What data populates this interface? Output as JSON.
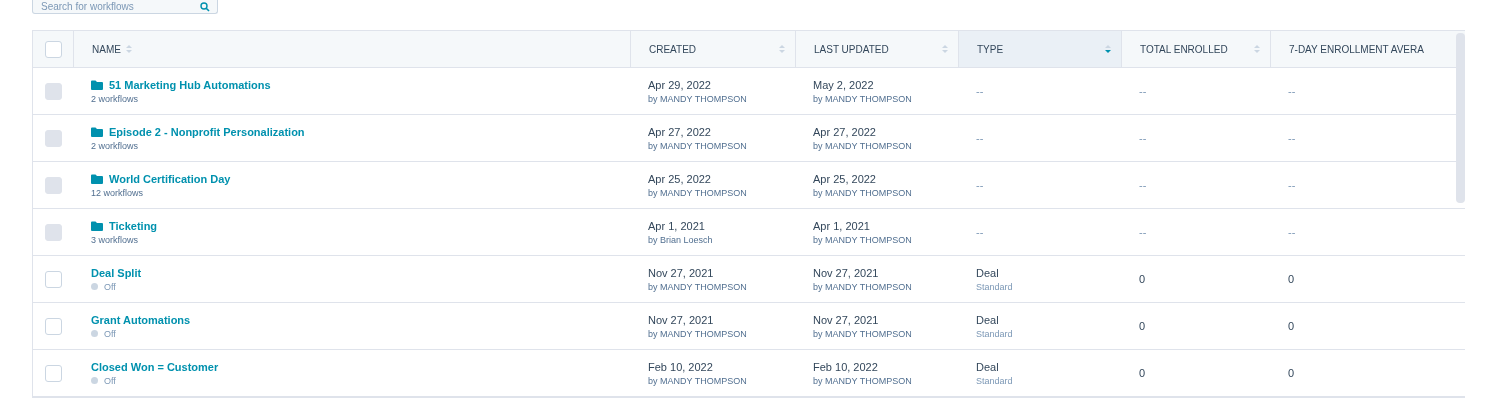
{
  "search": {
    "placeholder": "Search for workflows"
  },
  "table": {
    "select_all": {
      "checked": false
    },
    "columns": [
      {
        "label": "NAME",
        "sortable": true,
        "sorted": false
      },
      {
        "label": "CREATED",
        "sortable": true,
        "sorted": false
      },
      {
        "label": "LAST UPDATED",
        "sortable": true,
        "sorted": false
      },
      {
        "label": "TYPE",
        "sortable": true,
        "sorted": true
      },
      {
        "label": "TOTAL ENROLLED",
        "sortable": true,
        "sorted": false
      },
      {
        "label": "7-DAY ENROLLMENT AVERA",
        "sortable": false
      }
    ],
    "rows": [
      {
        "kind": "folder",
        "disabled": true,
        "name": "51 Marketing Hub Automations",
        "sub": "2 workflows",
        "created": "Apr 29, 2022",
        "created_by": "by MANDY THOMPSON",
        "updated": "May 2, 2022",
        "updated_by": "by MANDY THOMPSON",
        "type": "--",
        "total": "--",
        "avg": "--"
      },
      {
        "kind": "folder",
        "disabled": true,
        "name": "Episode 2 - Nonprofit Personalization",
        "sub": "2 workflows",
        "created": "Apr 27, 2022",
        "created_by": "by MANDY THOMPSON",
        "updated": "Apr 27, 2022",
        "updated_by": "by MANDY THOMPSON",
        "type": "--",
        "total": "--",
        "avg": "--"
      },
      {
        "kind": "folder",
        "disabled": true,
        "name": "World Certification Day",
        "sub": "12 workflows",
        "created": "Apr 25, 2022",
        "created_by": "by MANDY THOMPSON",
        "updated": "Apr 25, 2022",
        "updated_by": "by MANDY THOMPSON",
        "type": "--",
        "total": "--",
        "avg": "--"
      },
      {
        "kind": "folder",
        "disabled": true,
        "name": "Ticketing",
        "sub": "3 workflows",
        "created": "Apr 1, 2021",
        "created_by": "by Brian Loesch",
        "updated": "Apr 1, 2021",
        "updated_by": "by MANDY THOMPSON",
        "type": "--",
        "total": "--",
        "avg": "--"
      },
      {
        "kind": "workflow",
        "disabled": false,
        "name": "Deal Split",
        "on": false,
        "sub": "Off",
        "created": "Nov 27, 2021",
        "created_by": "by MANDY THOMPSON",
        "updated": "Nov 27, 2021",
        "updated_by": "by MANDY THOMPSON",
        "type": "Deal",
        "type_sub": "Standard",
        "total": "0",
        "avg": "0"
      },
      {
        "kind": "workflow",
        "disabled": false,
        "name": "Grant Automations",
        "on": false,
        "sub": "Off",
        "created": "Nov 27, 2021",
        "created_by": "by MANDY THOMPSON",
        "updated": "Nov 27, 2021",
        "updated_by": "by MANDY THOMPSON",
        "type": "Deal",
        "type_sub": "Standard",
        "total": "0",
        "avg": "0"
      },
      {
        "kind": "workflow",
        "disabled": false,
        "name": "Closed Won = Customer",
        "on": false,
        "sub": "Off",
        "created": "Feb 10, 2022",
        "created_by": "by MANDY THOMPSON",
        "updated": "Feb 10, 2022",
        "updated_by": "by MANDY THOMPSON",
        "type": "Deal",
        "type_sub": "Standard",
        "total": "0",
        "avg": "0"
      }
    ]
  }
}
